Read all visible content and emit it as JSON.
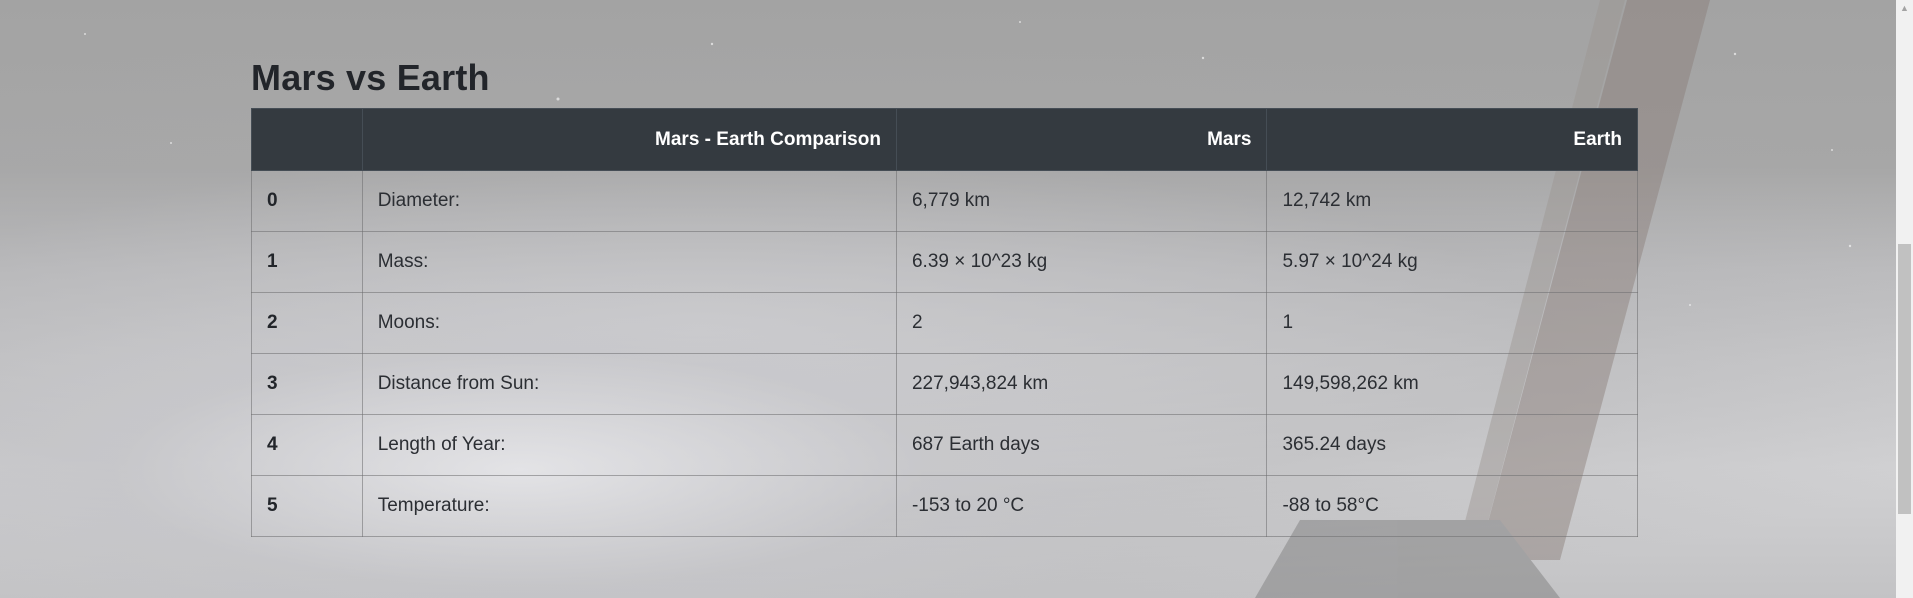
{
  "page": {
    "title": "Mars vs Earth"
  },
  "table": {
    "headers": [
      "",
      "Mars - Earth Comparison",
      "Mars",
      "Earth"
    ],
    "rows": [
      {
        "index": "0",
        "metric": "Diameter:",
        "mars": "6,779 km",
        "earth": "12,742 km"
      },
      {
        "index": "1",
        "metric": "Mass:",
        "mars": "6.39 × 10^23 kg",
        "earth": "5.97 × 10^24 kg"
      },
      {
        "index": "2",
        "metric": "Moons:",
        "mars": "2",
        "earth": "1"
      },
      {
        "index": "3",
        "metric": "Distance from Sun:",
        "mars": "227,943,824 km",
        "earth": "149,598,262 km"
      },
      {
        "index": "4",
        "metric": "Length of Year:",
        "mars": "687 Earth days",
        "earth": "365.24 days"
      },
      {
        "index": "5",
        "metric": "Temperature:",
        "mars": "-153 to 20 °C",
        "earth": "-88 to 58°C"
      }
    ]
  },
  "scrollbar": {
    "up_arrow_icon": "triangle-up-icon",
    "position_fraction": 0.41
  },
  "colors": {
    "header_bg": "#343a40",
    "header_text": "#ffffff",
    "title_text": "#22252a"
  }
}
